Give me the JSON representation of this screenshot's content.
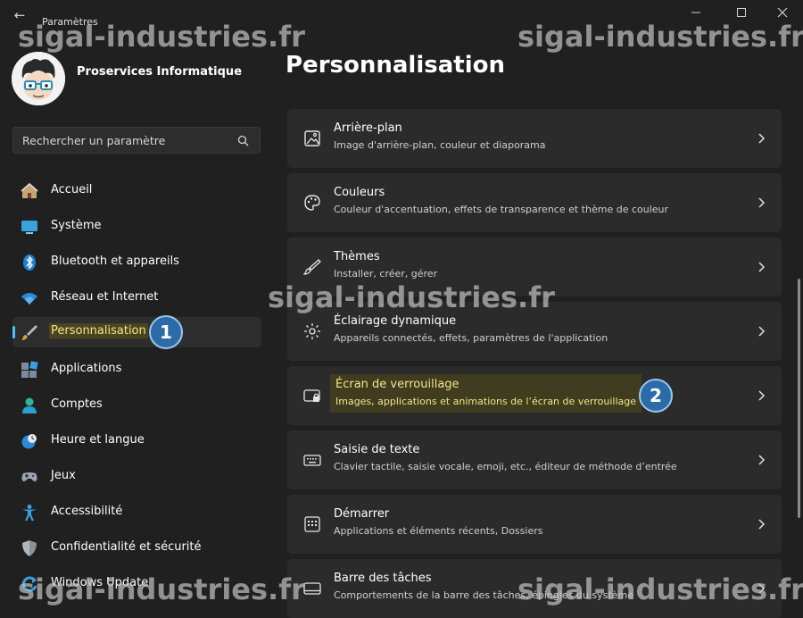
{
  "window": {
    "app_title": "Paramètres",
    "back_glyph": "←",
    "minimize_glyph": "—",
    "maximize_glyph": "☐",
    "close_glyph": "✕"
  },
  "user": {
    "name": "Proservices Informatique",
    "avatar": "avatar-cartoon-glasses"
  },
  "search": {
    "placeholder": "Rechercher un paramètre",
    "icon": "search-icon"
  },
  "sidebar": {
    "items": [
      {
        "label": "Accueil",
        "icon": "home-icon",
        "selected": false
      },
      {
        "label": "Système",
        "icon": "system-icon",
        "selected": false
      },
      {
        "label": "Bluetooth et appareils",
        "icon": "bluetooth-icon",
        "selected": false
      },
      {
        "label": "Réseau et Internet",
        "icon": "wifi-icon",
        "selected": false
      },
      {
        "label": "Personnalisation",
        "icon": "brush-icon",
        "selected": true
      },
      {
        "label": "Applications",
        "icon": "apps-icon",
        "selected": false
      },
      {
        "label": "Comptes",
        "icon": "account-icon",
        "selected": false
      },
      {
        "label": "Heure et langue",
        "icon": "clock-globe-icon",
        "selected": false
      },
      {
        "label": "Jeux",
        "icon": "gamepad-icon",
        "selected": false
      },
      {
        "label": "Accessibilité",
        "icon": "accessibility-icon",
        "selected": false
      },
      {
        "label": "Confidentialité et sécurité",
        "icon": "shield-icon",
        "selected": false
      },
      {
        "label": "Windows Update",
        "icon": "update-icon",
        "selected": false
      }
    ]
  },
  "main": {
    "title": "Personnalisation",
    "cards": [
      {
        "title": "Arrière-plan",
        "subtitle": "Image d'arrière-plan, couleur et diaporama",
        "icon": "image-icon"
      },
      {
        "title": "Couleurs",
        "subtitle": "Couleur d'accentuation, effets de transparence et thème de couleur",
        "icon": "palette-icon"
      },
      {
        "title": "Thèmes",
        "subtitle": "Installer, créer, gérer",
        "icon": "brush-icon"
      },
      {
        "title": "Éclairage dynamique",
        "subtitle": "Appareils connectés, effets, paramètres de l'application",
        "icon": "lighting-icon"
      },
      {
        "title": "Écran de verrouillage",
        "subtitle": "Images, applications et animations de l’écran de verrouillage",
        "icon": "lock-screen-icon"
      },
      {
        "title": "Saisie de texte",
        "subtitle": "Clavier tactile, saisie vocale, emoji, etc., éditeur de méthode d’entrée",
        "icon": "keyboard-icon"
      },
      {
        "title": "Démarrer",
        "subtitle": "Applications et éléments récents, Dossiers",
        "icon": "start-icon"
      },
      {
        "title": "Barre des tâches",
        "subtitle": "Comportements de la barre des tâches, épingles du système",
        "icon": "taskbar-icon"
      }
    ]
  },
  "annotations": {
    "step1": "1",
    "step2": "2"
  },
  "watermark": "sigal-industries.fr",
  "colors": {
    "background": "#202020",
    "card": "#2b2b2b",
    "accent": "#4cc2ff",
    "highlight_text": "#f5e58a",
    "badge": "#2b6ca8"
  }
}
